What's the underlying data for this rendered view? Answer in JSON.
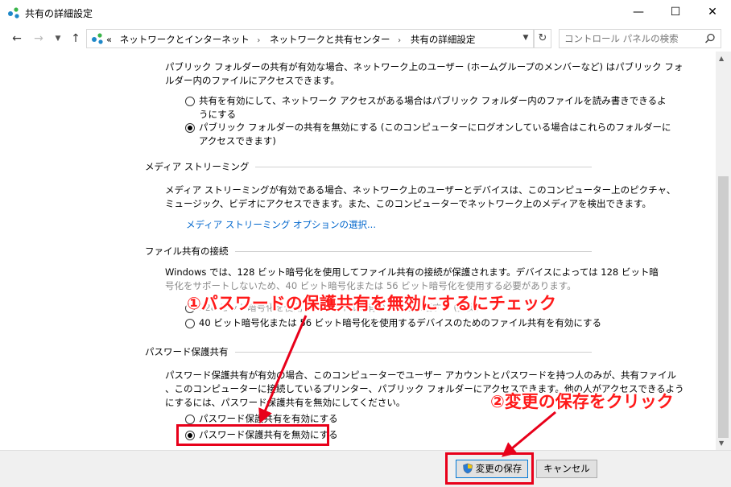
{
  "window": {
    "title": "共有の詳細設定",
    "minimize": "—",
    "maximize": "☐",
    "close": "✕"
  },
  "nav": {
    "back": "←",
    "forward": "→",
    "recent": "▼",
    "up": "↑",
    "breadcrumb_prefix": "«",
    "crumbs": [
      "ネットワークとインターネット",
      "ネットワークと共有センター",
      "共有の詳細設定"
    ],
    "separator": "›",
    "dropdown": "▼",
    "refresh": "↻",
    "search_placeholder": "コントロール パネルの検索"
  },
  "public_folder": {
    "description_line1": "パブリック フォルダーの共有が有効な場合、ネットワーク上のユーザー (ホームグループのメンバーなど) はパブリック フォ",
    "description_line2": "ルダー内のファイルにアクセスできます。",
    "option1_line1": "共有を有効にして、ネットワーク アクセスがある場合はパブリック フォルダー内のファイルを読み書きできるよ",
    "option1_line2": "うにする",
    "option1_checked": false,
    "option2_line1": "パブリック フォルダーの共有を無効にする (このコンピューターにログオンしている場合はこれらのフォルダーに",
    "option2_line2": "アクセスできます)",
    "option2_checked": true
  },
  "media_streaming": {
    "title": "メディア ストリーミング",
    "description_line1": "メディア ストリーミングが有効である場合、ネットワーク上のユーザーとデバイスは、このコンピューター上のピクチャ、",
    "description_line2": "ミュージック、ビデオにアクセスできます。また、このコンピューターでネットワーク上のメディアを検出できます。",
    "link": "メディア ストリーミング オプションの選択..."
  },
  "file_sharing": {
    "title": "ファイル共有の接続",
    "description_line1": "Windows では、128 ビット暗号化を使用してファイル共有の接続が保護されます。デバイスによっては 128 ビット暗",
    "description_line2": "号化をサポートしないため、40 ビット暗号化または 56 ビット暗号化を使用する必要があります。",
    "option1": "128 ビット暗号化を使用してファイル共有の接続を保護する (推奨)",
    "option1_checked": false,
    "option2": "40 ビット暗号化または 56 ビット暗号化を使用するデバイスのためのファイル共有を有効にする",
    "option2_checked": false
  },
  "password_sharing": {
    "title": "パスワード保護共有",
    "description_line1": "パスワード保護共有が有効の場合、このコンピューターでユーザー アカウントとパスワードを持つ人のみが、共有ファイル",
    "description_line2": "、このコンピューターに接続しているプリンター、パブリック フォルダーにアクセスできます。他の人がアクセスできるよう",
    "description_line3": "にするには、パスワード保護共有を無効にしてください。",
    "option_enable": "パスワード保護共有を有効にする",
    "option_enable_checked": false,
    "option_disable": "パスワード保護共有を無効にする",
    "option_disable_checked": true
  },
  "footer": {
    "save": "変更の保存",
    "cancel": "キャンセル"
  },
  "annotations": {
    "step1": "①パスワードの保護共有を無効にするにチェック",
    "step2": "②変更の保存をクリック",
    "color": "#ff1a1a"
  }
}
